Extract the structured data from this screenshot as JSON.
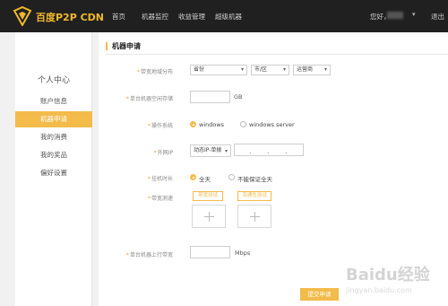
{
  "brand": {
    "name": "百度P2P CDN"
  },
  "nav": [
    {
      "label": "首页"
    },
    {
      "label": "机器监控"
    },
    {
      "label": "收益管理"
    },
    {
      "label": "超级机器"
    }
  ],
  "user": {
    "greeting": "您好，",
    "logout": "退出"
  },
  "sidebar": {
    "title": "个人中心",
    "items": [
      {
        "label": "账户信息",
        "active": false
      },
      {
        "label": "机器申请",
        "active": true
      },
      {
        "label": "我的消费",
        "active": false
      },
      {
        "label": "我的奖品",
        "active": false
      },
      {
        "label": "偏好设置",
        "active": false
      }
    ]
  },
  "form": {
    "section_title": "机器申请",
    "region": {
      "label": "带宽地域分布",
      "province": "省份",
      "city": "市/区",
      "isp": "运营商"
    },
    "storage": {
      "label": "单台机器空闲存储",
      "value": "",
      "unit": "GB"
    },
    "os": {
      "label": "操作系统",
      "options": [
        "windows",
        "windows server"
      ],
      "selected": "windows"
    },
    "ip": {
      "label": "外网IP",
      "type": "动态IP-单拨",
      "value": [
        "",
        "",
        "",
        ""
      ]
    },
    "online": {
      "label": "挂机时长",
      "options": [
        "全天",
        "不能保证全天"
      ],
      "selected": "全天"
    },
    "speedtest": {
      "label": "带宽测速",
      "buttons": [
        "带宽测试",
        "流通性测试"
      ]
    },
    "upload": {
      "label": "单台机器上行带宽",
      "value": "",
      "unit": "Mbps"
    },
    "submit_label": "提交申请"
  },
  "watermark": {
    "text": "Baidu经验",
    "sub": "jingyan.baidu.com"
  },
  "colors": {
    "accent": "#f2bb4a",
    "topbar": "#202020",
    "brand": "#f0b82a"
  }
}
